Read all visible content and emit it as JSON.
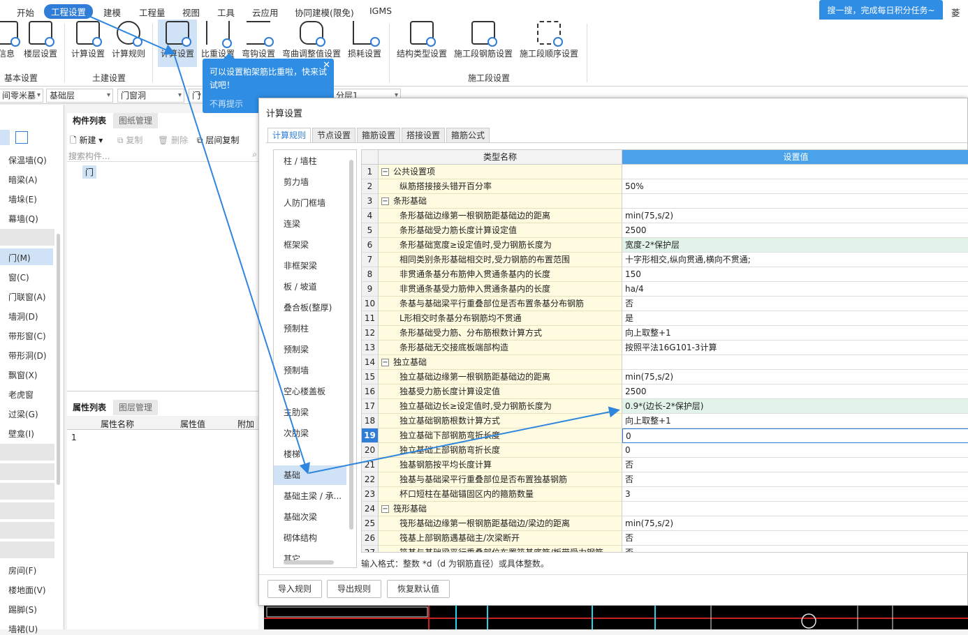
{
  "menu": {
    "items": [
      "开始",
      "工程设置",
      "建模",
      "工程量",
      "视图",
      "工具",
      "云应用",
      "协同建模(限免)",
      "IGMS"
    ],
    "active": "工程设置",
    "top_note": "搜一搜，完成每日积分任务~",
    "top_right": "菱层"
  },
  "ribbon": {
    "buttons": [
      "信息",
      "楼层设置",
      "计算设置",
      "计算规则",
      "计算设置",
      "比重设置",
      "弯钩设置",
      "弯曲调整值设置",
      "损耗设置",
      "结构类型设置",
      "施工段钢筋设置",
      "施工段顺序设置"
    ],
    "groups": [
      "基本设置",
      "土建设置",
      "施工段设置"
    ]
  },
  "tooltip": {
    "text": "可以设置粕架筋比重啦，快来试试吧！",
    "no_more": "不再提示"
  },
  "toolbar2": {
    "combo1": "间零米墓",
    "combo2": "基础层",
    "combo3": "门窗洞",
    "combo4": "门",
    "combo5": "分层1"
  },
  "left_panel": {
    "items": [
      "保温墙(Q)",
      "暗梁(A)",
      "墙垛(E)",
      "幕墙(Q)",
      "门(M)",
      "窗(C)",
      "门联窗(A)",
      "墙洞(D)",
      "带形窗(C)",
      "带形洞(D)",
      "飘窗(X)",
      "老虎窗",
      "过梁(G)",
      "壁龛(I)",
      "房间(F)",
      "楼地面(V)",
      "踢脚(S)",
      "墙裙(U)"
    ]
  },
  "mid_panel": {
    "tab_components": "构件列表",
    "tab_drawings": "图纸管理",
    "btn_new": "新建",
    "btn_copy": "复制",
    "btn_delete": "删除",
    "btn_floor_copy": "层间复制",
    "search_placeholder": "搜索构件...",
    "component": "门",
    "tab_props": "属性列表",
    "tab_layers": "图层管理",
    "col_name": "属性名称",
    "col_value": "属性值",
    "col_extra": "附加",
    "row1": "1"
  },
  "dialog": {
    "title": "计算设置",
    "tabs": [
      "计算规则",
      "节点设置",
      "箍筋设置",
      "搭接设置",
      "箍筋公式"
    ],
    "categories": [
      "柱 / 墙柱",
      "剪力墙",
      "人防门框墙",
      "连梁",
      "框架梁",
      "非框架梁",
      "板 / 坡道",
      "叠合板(整厚)",
      "预制柱",
      "预制梁",
      "预制墙",
      "空心楼盖板",
      "主肋梁",
      "次肋梁",
      "楼梯",
      "基础",
      "基础主梁 / 承...",
      "基础次梁",
      "砌体结构",
      "其它"
    ],
    "selected_category": "基础",
    "col_name": "类型名称",
    "col_value": "设置值",
    "rows": [
      {
        "no": "1",
        "name": "公共设置项",
        "value": "",
        "header": true
      },
      {
        "no": "2",
        "name": "纵筋搭接接头错开百分率",
        "value": "50%"
      },
      {
        "no": "3",
        "name": "条形基础",
        "value": "",
        "header": true
      },
      {
        "no": "4",
        "name": "条形基础边缘第一根钢筋距基础边的距离",
        "value": "min(75,s/2)"
      },
      {
        "no": "5",
        "name": "条形基础受力筋长度计算设定值",
        "value": "2500"
      },
      {
        "no": "6",
        "name": "条形基础宽度≥设定值时,受力钢筋长度为",
        "value": "宽度-2*保护层",
        "green": true
      },
      {
        "no": "7",
        "name": "相同类别条形基础相交时,受力钢筋的布置范围",
        "value": "十字形相交,纵向贯通,横向不贯通;"
      },
      {
        "no": "8",
        "name": "非贯通条基分布筋伸入贯通条基内的长度",
        "value": "150"
      },
      {
        "no": "9",
        "name": "非贯通条基受力筋伸入贯通条基内的长度",
        "value": "ha/4"
      },
      {
        "no": "10",
        "name": "条基与基础梁平行重叠部位是否布置条基分布钢筋",
        "value": "否"
      },
      {
        "no": "11",
        "name": "L形相交时条基分布钢筋均不贯通",
        "value": "是"
      },
      {
        "no": "12",
        "name": "条形基础受力筋、分布筋根数计算方式",
        "value": "向上取整+1"
      },
      {
        "no": "13",
        "name": "条形基础无交接底板端部构造",
        "value": "按照平法16G101-3计算"
      },
      {
        "no": "14",
        "name": "独立基础",
        "value": "",
        "header": true
      },
      {
        "no": "15",
        "name": "独立基础边缘第一根钢筋距基础边的距离",
        "value": "min(75,s/2)"
      },
      {
        "no": "16",
        "name": "独基受力筋长度计算设定值",
        "value": "2500"
      },
      {
        "no": "17",
        "name": "独立基础边长≥设定值时,受力钢筋长度为",
        "value": "0.9*(边长-2*保护层)",
        "green": true
      },
      {
        "no": "18",
        "name": "独立基础钢筋根数计算方式",
        "value": "向上取整+1"
      },
      {
        "no": "19",
        "name": "独立基础下部钢筋弯折长度",
        "value": "0",
        "selected": true
      },
      {
        "no": "20",
        "name": "独立基础上部钢筋弯折长度",
        "value": "0"
      },
      {
        "no": "21",
        "name": "独基钢筋按平均长度计算",
        "value": "否"
      },
      {
        "no": "22",
        "name": "独基与基础梁平行重叠部位是否布置独基钢筋",
        "value": "否"
      },
      {
        "no": "23",
        "name": "杯口短柱在基础锚固区内的箍筋数量",
        "value": "3"
      },
      {
        "no": "24",
        "name": "筏形基础",
        "value": "",
        "header": true
      },
      {
        "no": "25",
        "name": "筏形基础边缘第一根钢筋距基础边/梁边的距离",
        "value": "min(75,s/2)"
      },
      {
        "no": "26",
        "name": "筏基上部钢筋遇基础主/次梁断开",
        "value": "否"
      },
      {
        "no": "27",
        "name": "筏基与基础梁平行重叠部位布置筏基底筋/板带受力钢筋",
        "value": "否"
      }
    ],
    "hint": "输入格式：整数 *d（d 为钢筋直径）或具体整数。",
    "btn_import": "导入规则",
    "btn_export": "导出规则",
    "btn_restore": "恢复默认值"
  },
  "colors": {
    "accent": "#2f7dd6",
    "tooltip": "#2f8de4",
    "name_bg": "#fffbe0",
    "green_bg": "#e2f3ea"
  }
}
